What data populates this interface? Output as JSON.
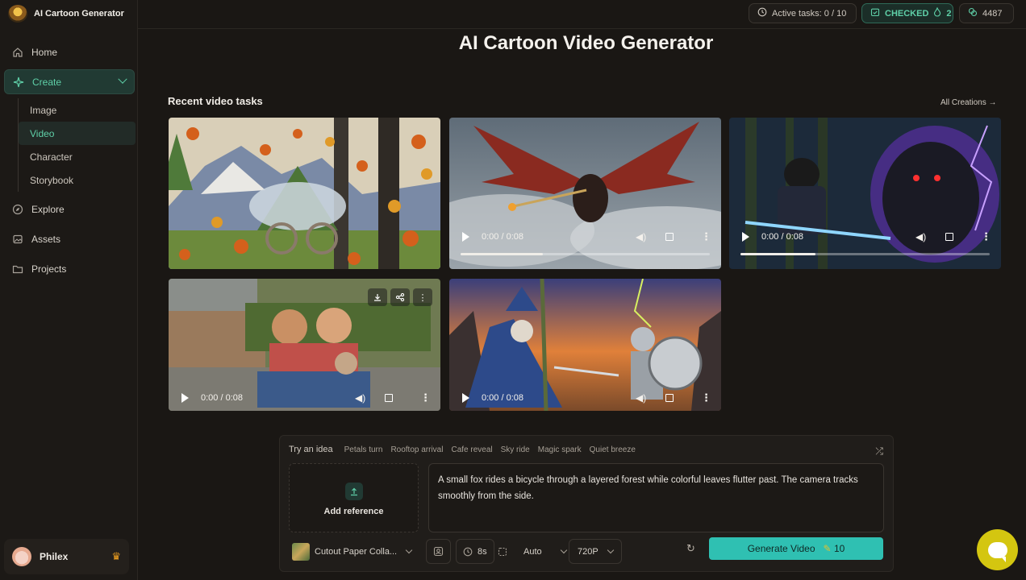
{
  "brand": {
    "name": "AI Cartoon Generator"
  },
  "nav": {
    "home": "Home",
    "create": "Create",
    "sub": [
      "Image",
      "Video",
      "Character",
      "Storybook"
    ],
    "explore": "Explore",
    "assets": "Assets",
    "projects": "Projects"
  },
  "user": {
    "name": "Philex"
  },
  "topbar": {
    "active_tasks": "Active tasks: 0 / 10",
    "checked_label": "CHECKED",
    "checked_count": "2",
    "credits": "4487"
  },
  "page": {
    "title": "AI Cartoon Video Generator",
    "section_title": "Recent video tasks",
    "all_creations": "All Creations →"
  },
  "videos": [
    {
      "time": "",
      "progress": 0
    },
    {
      "time": "0:00 / 0:08",
      "progress": 0.33
    },
    {
      "time": "0:00 / 0:08",
      "progress": 0.3
    },
    {
      "time": "0:00 / 0:08",
      "progress": 0
    },
    {
      "time": "0:00 / 0:08",
      "progress": 0
    }
  ],
  "panel": {
    "try_label": "Try an idea",
    "ideas": [
      "Petals turn",
      "Rooftop arrival",
      "Cafe reveal",
      "Sky ride",
      "Magic spark",
      "Quiet breeze"
    ],
    "add_reference": "Add reference",
    "prompt": "A small fox rides a bicycle through a layered forest while colorful leaves flutter past. The camera tracks smoothly from the side.",
    "style": "Cutout Paper Colla...",
    "duration": "8s",
    "ratio": "Auto",
    "resolution": "720P",
    "generate_label": "Generate Video",
    "generate_cost": "10"
  },
  "colors": {
    "accent": "#5fd0a8",
    "button": "#2fc0b2",
    "chat": "#d4c610"
  }
}
